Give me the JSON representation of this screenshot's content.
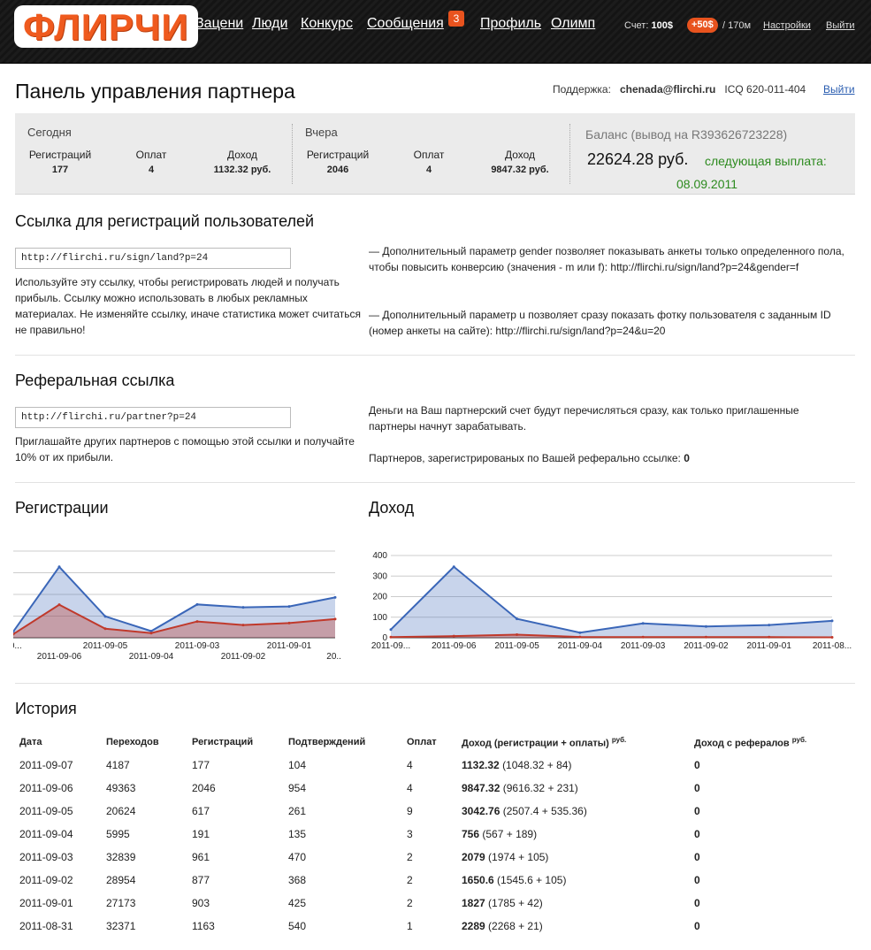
{
  "header": {
    "logo": "ФЛИРЧИ",
    "nav": [
      "Зацени",
      "Люди",
      "Конкурс",
      "Сообщения",
      "Профиль",
      "Олимп"
    ],
    "messages_badge": "3",
    "account": {
      "label": "Счет:",
      "amount": "100$",
      "bonus": "+50$",
      "limit": "/ 170м"
    },
    "settings_link": "Настройки",
    "logout_link": "Выйти"
  },
  "page": {
    "title": "Панель управления партнера",
    "support_label": "Поддержка:",
    "support_email": "chenada@flirchi.ru",
    "support_icq": "ICQ 620-011-404",
    "logout_link": "Выйти"
  },
  "stats": {
    "today": {
      "title": "Сегодня",
      "reg_label": "Регистраций",
      "pay_label": "Оплат",
      "income_label": "Доход",
      "reg": "177",
      "pay": "4",
      "income": "1132.32 руб."
    },
    "yesterday": {
      "title": "Вчера",
      "reg_label": "Регистраций",
      "pay_label": "Оплат",
      "income_label": "Доход",
      "reg": "2046",
      "pay": "4",
      "income": "9847.32 руб."
    },
    "balance": {
      "title": "Баланс (вывод на R393626723228)",
      "value": "22624.28 руб.",
      "next_label": "следующая выплата:",
      "next_date": "08.09.2011"
    }
  },
  "reg_link_section": {
    "title": "Ссылка для регистраций пользователей",
    "url": "http://flirchi.ru/sign/land?p=24",
    "desc": "Используйте эту ссылку, чтобы регистрировать людей и получать прибыль. Ссылку можно использовать в любых рекламных материалах. Не изменяйте ссылку, иначе статистика может считаться не правильно!",
    "note1": "— Дополнительный параметр gender позволяет показывать анкеты только определенного пола, чтобы повысить конверсию (значения - m или f): http://flirchi.ru/sign/land?p=24&gender=f",
    "note2": "— Дополнительный параметр u позволяет сразу показать фотку пользователя с заданным ID (номер анкеты на сайте): http://flirchi.ru/sign/land?p=24&u=20"
  },
  "ref_section": {
    "title": "Реферальная ссылка",
    "url": "http://flirchi.ru/partner?p=24",
    "desc": "Приглашайте других партнеров с помощью этой ссылки и получайте 10% от их прибыли.",
    "note": "Деньги на Ваш партнерский счет будут перечисляться сразу, как только приглашенные партнеры начнут зарабатывать.",
    "partners_label": "Партнеров, зарегистрированых по Вашей реферально ссылке:",
    "partners_count": "0"
  },
  "charts": {
    "registrations_title": "Регистрации",
    "income_title": "Доход"
  },
  "chart_data": [
    {
      "type": "area",
      "title": "Регистрации",
      "x": [
        "2011-09-07",
        "2011-09-06",
        "2011-09-05",
        "2011-09-04",
        "2011-09-03",
        "2011-09-02",
        "2011-09-01",
        "2011-08-31"
      ],
      "tick_labels_top": [
        "20...",
        "2011-09-05",
        "2011-09-03",
        "2011-09-01"
      ],
      "tick_labels_bottom": [
        "2011-09-06",
        "2011-09-04",
        "2011-09-02",
        "20..."
      ],
      "y_tick_labels": [
        "...",
        "...",
        "...",
        "...",
        "0"
      ],
      "ylim": [
        0,
        2500
      ],
      "series": [
        {
          "values": [
            177,
            2046,
            617,
            191,
            961,
            877,
            903,
            1163
          ],
          "color": "#3a66b8"
        },
        {
          "values": [
            104,
            954,
            261,
            135,
            470,
            368,
            425,
            540
          ],
          "color": "#c0392b"
        }
      ],
      "grid": true
    },
    {
      "type": "area",
      "title": "Доход",
      "x": [
        "2011-09-07",
        "2011-09-06",
        "2011-09-05",
        "2011-09-04",
        "2011-09-03",
        "2011-09-02",
        "2011-09-01",
        "2011-08-31"
      ],
      "tick_labels": [
        "2011-09...",
        "2011-09-06",
        "2011-09-05",
        "2011-09-04",
        "2011-09-03",
        "2011-09-02",
        "2011-09-01",
        "2011-08..."
      ],
      "y_ticks": [
        0,
        100,
        200,
        300,
        400
      ],
      "ylim": [
        0,
        400
      ],
      "series": [
        {
          "values": [
            40,
            345,
            92,
            25,
            70,
            55,
            62,
            82
          ],
          "color": "#3a66b8"
        },
        {
          "values": [
            3,
            8,
            15,
            4,
            3,
            3,
            3,
            2
          ],
          "color": "#c0392b"
        }
      ],
      "grid": true
    }
  ],
  "history": {
    "title": "История",
    "headers": [
      "Дата",
      "Переходов",
      "Регистраций",
      "Подтверждений",
      "Оплат",
      "Доход (регистрации + оплаты)",
      "Доход с рефералов"
    ],
    "currency_sup": "руб.",
    "rows": [
      {
        "date": "2011-09-07",
        "clicks": "4187",
        "regs": "177",
        "confirm": "104",
        "pays": "4",
        "income": "1132.32",
        "income_detail": "(1048.32 + 84)",
        "ref": "0"
      },
      {
        "date": "2011-09-06",
        "clicks": "49363",
        "regs": "2046",
        "confirm": "954",
        "pays": "4",
        "income": "9847.32",
        "income_detail": "(9616.32 + 231)",
        "ref": "0"
      },
      {
        "date": "2011-09-05",
        "clicks": "20624",
        "regs": "617",
        "confirm": "261",
        "pays": "9",
        "income": "3042.76",
        "income_detail": "(2507.4 + 535.36)",
        "ref": "0"
      },
      {
        "date": "2011-09-04",
        "clicks": "5995",
        "regs": "191",
        "confirm": "135",
        "pays": "3",
        "income": "756",
        "income_detail": "(567 + 189)",
        "ref": "0"
      },
      {
        "date": "2011-09-03",
        "clicks": "32839",
        "regs": "961",
        "confirm": "470",
        "pays": "2",
        "income": "2079",
        "income_detail": "(1974 + 105)",
        "ref": "0"
      },
      {
        "date": "2011-09-02",
        "clicks": "28954",
        "regs": "877",
        "confirm": "368",
        "pays": "2",
        "income": "1650.6",
        "income_detail": "(1545.6 + 105)",
        "ref": "0"
      },
      {
        "date": "2011-09-01",
        "clicks": "27173",
        "regs": "903",
        "confirm": "425",
        "pays": "2",
        "income": "1827",
        "income_detail": "(1785 + 42)",
        "ref": "0"
      },
      {
        "date": "2011-08-31",
        "clicks": "32371",
        "regs": "1163",
        "confirm": "540",
        "pays": "1",
        "income": "2289",
        "income_detail": "(2268 + 21)",
        "ref": "0"
      }
    ]
  },
  "colors": {
    "accent": "#e8531e",
    "link": "#2a5db0",
    "green": "#2c8a1e",
    "blue_series": "#3a66b8",
    "red_series": "#c0392b"
  }
}
